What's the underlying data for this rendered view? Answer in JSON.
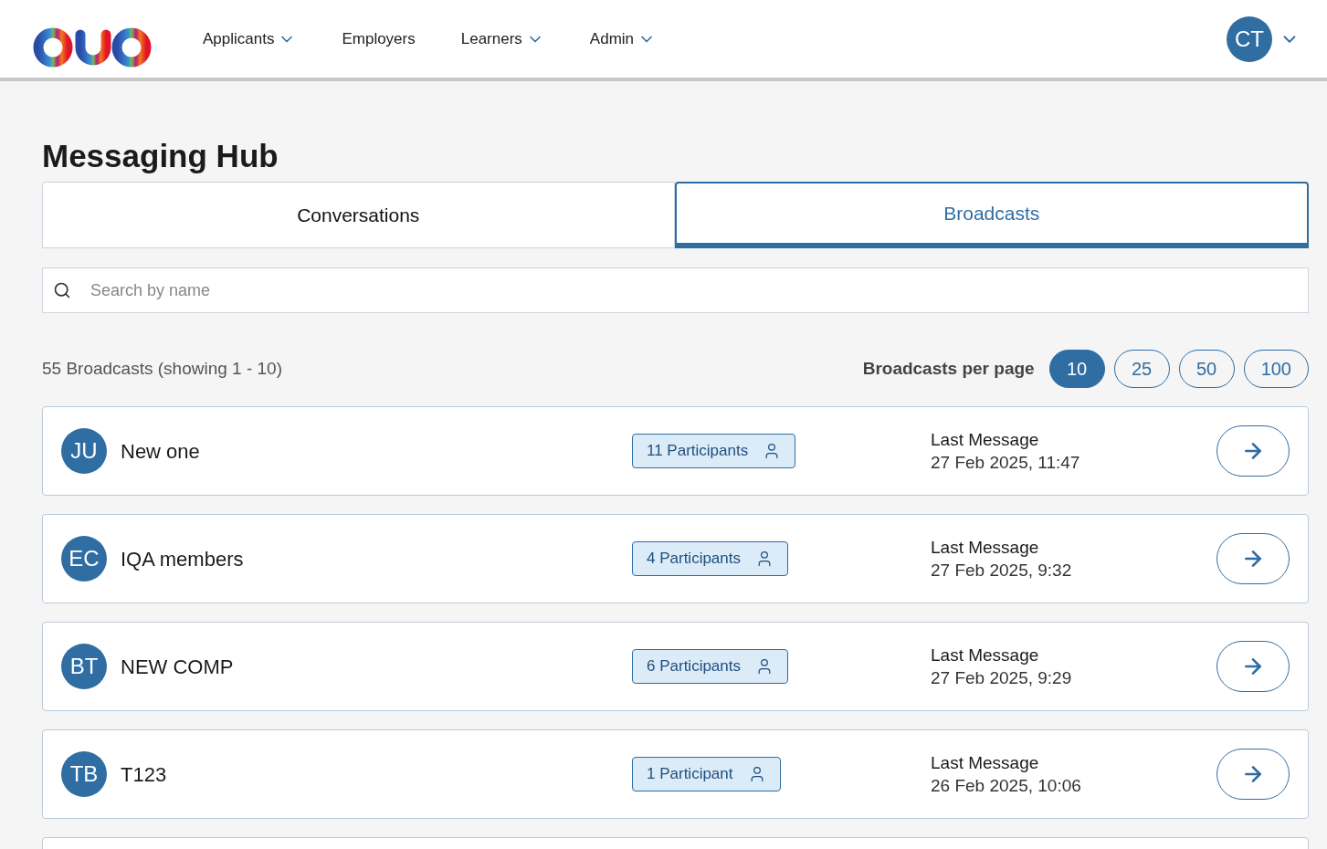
{
  "nav": {
    "items": [
      {
        "label": "Applicants",
        "has_menu": true
      },
      {
        "label": "Employers",
        "has_menu": false
      },
      {
        "label": "Learners",
        "has_menu": true
      },
      {
        "label": "Admin",
        "has_menu": true
      }
    ],
    "user_initials": "CT"
  },
  "page_title": "Messaging Hub",
  "tabs": [
    {
      "label": "Conversations",
      "selected": false
    },
    {
      "label": "Broadcasts",
      "selected": true
    }
  ],
  "search": {
    "placeholder": "Search by name"
  },
  "summary": "55 Broadcasts (showing 1 - 10)",
  "per_page": {
    "label": "Broadcasts per page",
    "options": [
      {
        "label": "10",
        "selected": true
      },
      {
        "label": "25",
        "selected": false
      },
      {
        "label": "50",
        "selected": false
      },
      {
        "label": "100",
        "selected": false
      }
    ]
  },
  "broadcasts": [
    {
      "initials": "JU",
      "name": "New one",
      "participants": "11 Participants",
      "last_label": "Last Message",
      "last_time": "27 Feb 2025, 11:47"
    },
    {
      "initials": "EC",
      "name": "IQA members",
      "participants": "4 Participants",
      "last_label": "Last Message",
      "last_time": "27 Feb 2025, 9:32"
    },
    {
      "initials": "BT",
      "name": "NEW COMP",
      "participants": "6 Participants",
      "last_label": "Last Message",
      "last_time": "27 Feb 2025, 9:29"
    },
    {
      "initials": "TB",
      "name": "T123",
      "participants": "1 Participant",
      "last_label": "Last Message",
      "last_time": "26 Feb 2025, 10:06"
    }
  ]
}
